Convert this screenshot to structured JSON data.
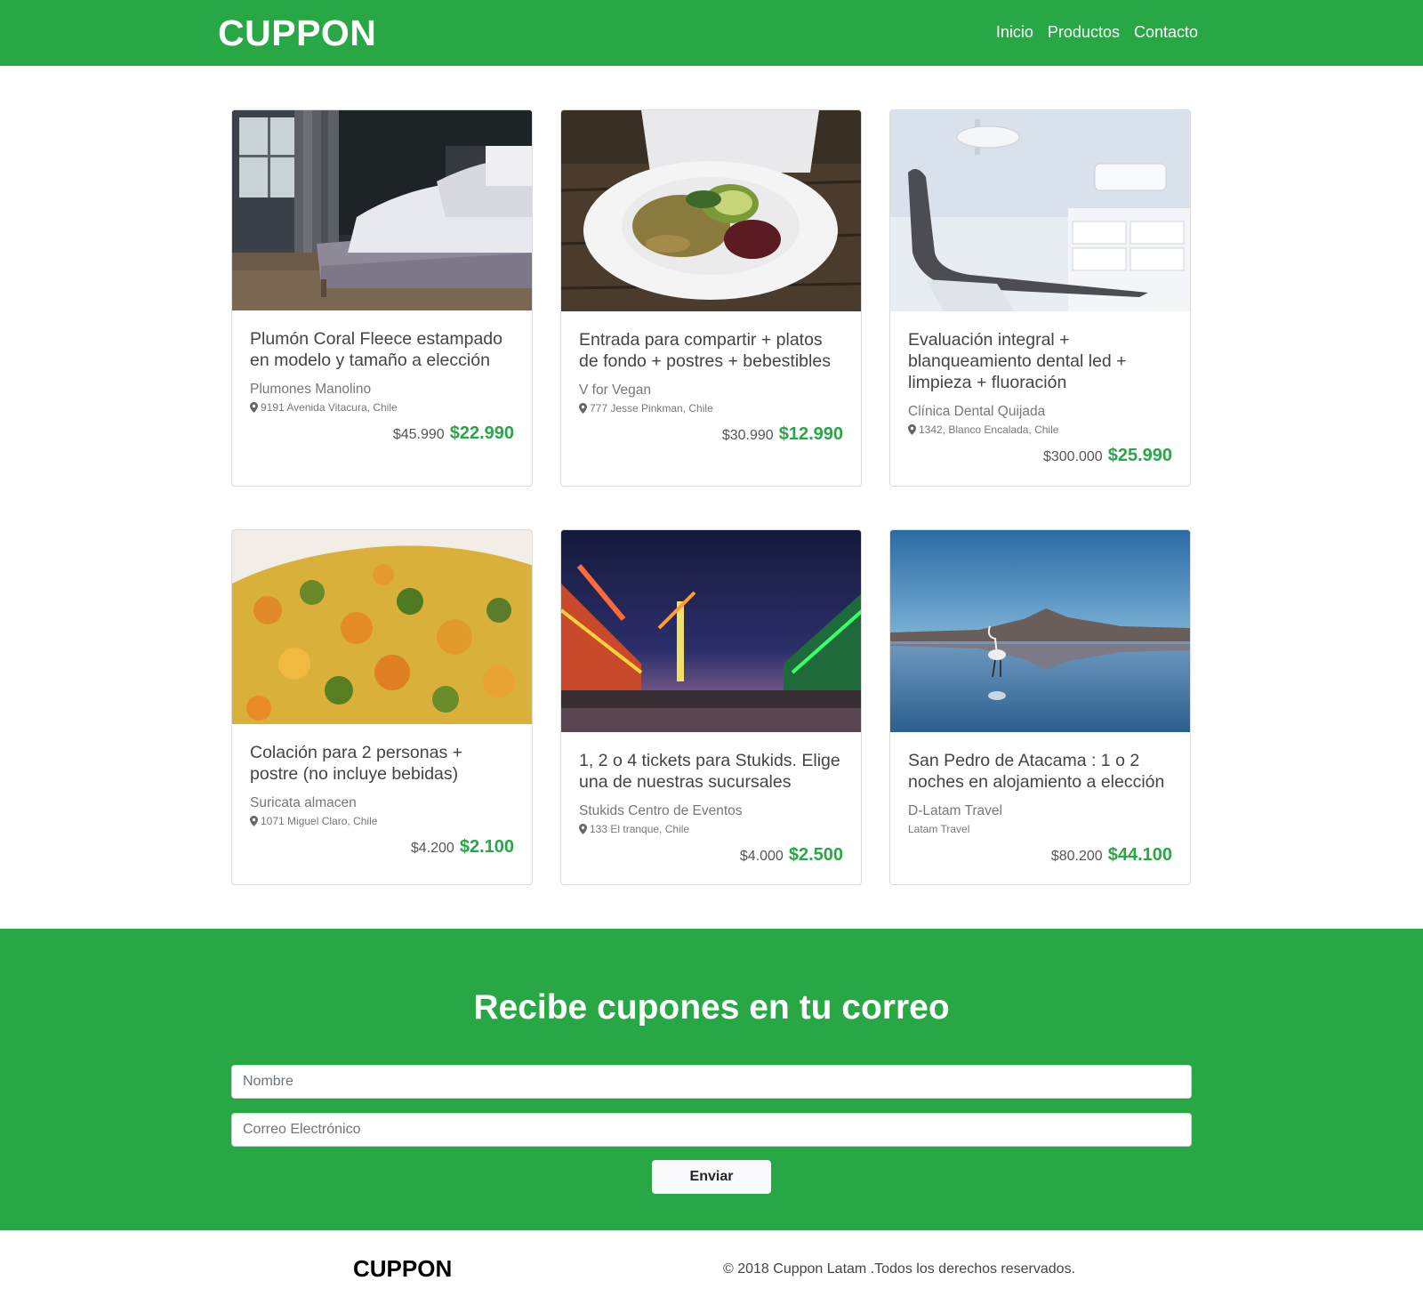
{
  "navbar": {
    "brand": "CUPPON",
    "links": [
      "Inicio",
      "Productos",
      "Contacto"
    ]
  },
  "colors": {
    "brand_green": "#28a745",
    "price_green": "#28a745"
  },
  "products": [
    {
      "title": "Plumón Coral Fleece estampado en modelo y tamaño a elección",
      "vendor": "Plumones Manolino",
      "address": "9191 Avenida Vitacura, Chile",
      "old_price": "$45.990",
      "new_price": "$22.990",
      "image": "bedroom-photo"
    },
    {
      "title": "Entrada para compartir + platos de fondo + postres + bebestibles",
      "vendor": "V for Vegan",
      "address": "777 Jesse Pinkman, Chile",
      "old_price": "$30.990",
      "new_price": "$12.990",
      "image": "vegan-dish-photo"
    },
    {
      "title": "Evaluación integral + blanqueamiento dental led + limpieza + fluoración",
      "vendor": "Clínica Dental Quijada",
      "address": "1342, Blanco Encalada, Chile",
      "old_price": "$300.000",
      "new_price": "$25.990",
      "image": "dental-chair-photo"
    },
    {
      "title": "Colación para 2 personas + postre (no incluye bebidas)",
      "vendor": "Suricata almacen",
      "address": "1071 Miguel Claro, Chile",
      "old_price": "$4.200",
      "new_price": "$2.100",
      "image": "vegetable-dish-photo"
    },
    {
      "title": "1, 2 o 4 tickets para Stukids. Elige una de nuestras sucursales",
      "vendor": "Stukids Centro de Eventos",
      "address": "133 El tranque, Chile",
      "old_price": "$4.000",
      "new_price": "$2.500",
      "image": "amusement-fair-photo"
    },
    {
      "title": "San Pedro de Atacama : 1 o 2 noches en alojamiento a elección",
      "vendor": "D-Latam Travel",
      "address": "Latam Travel",
      "old_price": "$80.200",
      "new_price": "$44.100",
      "image": "flamingo-lagoon-photo"
    }
  ],
  "subscribe": {
    "title": "Recibe cupones en tu correo",
    "name_placeholder": "Nombre",
    "email_placeholder": "Correo Electrónico",
    "button_label": "Enviar"
  },
  "footer": {
    "brand": "CUPPON",
    "copyright": "© 2018 Cuppon Latam .Todos los derechos reservados."
  }
}
